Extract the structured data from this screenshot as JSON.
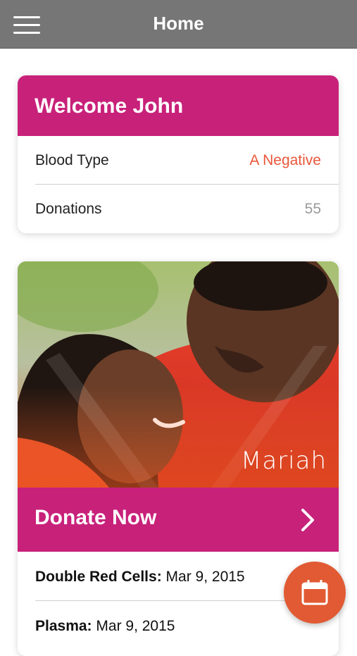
{
  "header": {
    "title": "Home",
    "menu_icon": "hamburger-menu-icon"
  },
  "welcome": {
    "title": "Welcome John",
    "rows": [
      {
        "label": "Blood Type",
        "value": "A Negative"
      },
      {
        "label": "Donations",
        "value": "55"
      }
    ]
  },
  "donate": {
    "hero_name": "Mariah",
    "cta_label": "Donate Now",
    "cta_icon": "chevron-right-icon",
    "items": [
      {
        "label": "Double Red Cells:",
        "value": "Mar 9, 2015"
      },
      {
        "label": "Plasma:",
        "value": "Mar 9, 2015"
      }
    ]
  },
  "fab": {
    "icon": "calendar-icon"
  },
  "colors": {
    "header_bg": "#767676",
    "accent": "#c8217a",
    "orange": "#e15a33",
    "blood_type": "#e8573a"
  }
}
